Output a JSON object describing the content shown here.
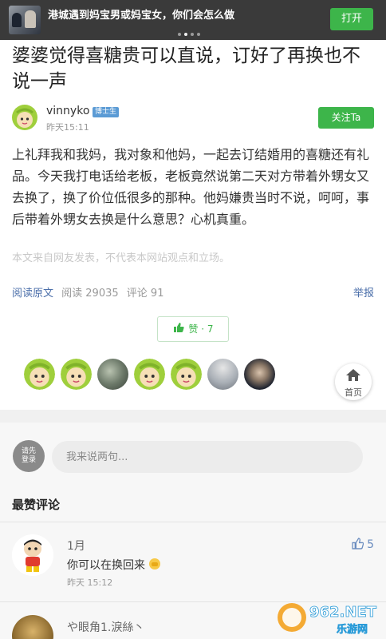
{
  "banner": {
    "text": "港城遇到妈宝男或妈宝女，你们会怎么做",
    "open_label": "打开"
  },
  "article": {
    "title": "婆婆觉得喜糖贵可以直说，订好了再换也不说一声",
    "author": "vinnyko",
    "author_badge": "博士生",
    "time": "昨天15:11",
    "follow_label": "关注Ta",
    "body": "上礼拜我和我妈，我对象和他妈，一起去订结婚用的喜糖还有礼品。今天我打电话给老板，老板竟然说第二天对方带着外甥女又去换了，换了价位低很多的那种。他妈嫌贵当时不说，呵呵，事后带着外甥女去换是什么意思？心机真重。",
    "disclaimer": "本文来自网友发表，不代表本网站观点和立场。",
    "read_original": "阅读原文",
    "reads": "阅读 29035",
    "comments": "评论 91",
    "report": "举报",
    "like_label": "赞",
    "like_sep": "·",
    "like_count": "7",
    "home_label": "首页"
  },
  "comment_box": {
    "login_line1": "请先",
    "login_line2": "登录",
    "placeholder": "我来说两句..."
  },
  "hot_comments": {
    "title": "最赞评论",
    "items": [
      {
        "name": "1月",
        "text": "你可以在换回来",
        "time": "昨天 15:12",
        "likes": "5"
      },
      {
        "name": "や眼角1.淚絲丶"
      }
    ]
  },
  "watermark": {
    "top": "962.NET",
    "bottom": "乐游网"
  },
  "colors": {
    "green": "#3db54a",
    "link": "#4a6ea9",
    "banner_bg": "#3a3a3a"
  }
}
